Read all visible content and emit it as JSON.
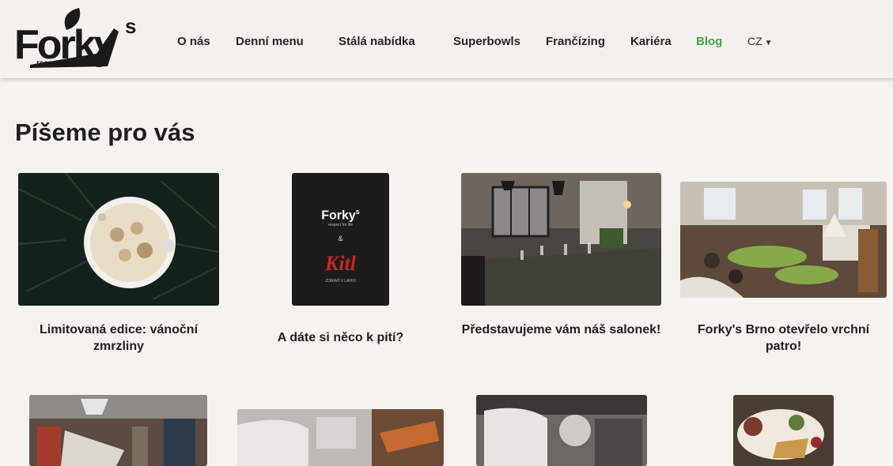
{
  "header": {
    "logo": {
      "brand": "Forky",
      "suffix": "s",
      "tagline": "respect for life"
    },
    "nav": [
      {
        "label": "O nás"
      },
      {
        "label": "Denní menu"
      },
      {
        "label": "Stálá nabídka"
      },
      {
        "label": "Superbowls"
      },
      {
        "label": "Frančízing"
      },
      {
        "label": "Kariéra"
      },
      {
        "label": "Blog",
        "active": true
      },
      {
        "label": "CZ",
        "caret": "▼"
      }
    ]
  },
  "main": {
    "title": "Píšeme pro vás",
    "posts": [
      {
        "title": "Limitovaná edice: vánoční zmrzliny",
        "image": "ice-cream-bowl-on-fir"
      },
      {
        "title": "A dáte si něco k pití?",
        "image": "forkys-kitl-poster",
        "poster": {
          "brand": "Forky",
          "suffix": "s",
          "tagline": "respect for life",
          "amp": "&",
          "partner": "Kitl",
          "partner_sub": "ZDRAVÍ V LAHVI"
        }
      },
      {
        "title": "Představujeme vám náš salonek!",
        "image": "salon-dining-room"
      },
      {
        "title": "Forky's Brno otevřelo vrchní patro!",
        "image": "brno-upper-floor"
      }
    ],
    "posts_row2": [
      {
        "image": "restaurant-interior"
      },
      {
        "image": "forkys-counter"
      },
      {
        "image": "chandelier-hall"
      },
      {
        "image": "food-plate"
      }
    ]
  },
  "colors": {
    "accent": "#47a34a",
    "background": "#f6f3ee",
    "text": "#1f1f1f"
  }
}
